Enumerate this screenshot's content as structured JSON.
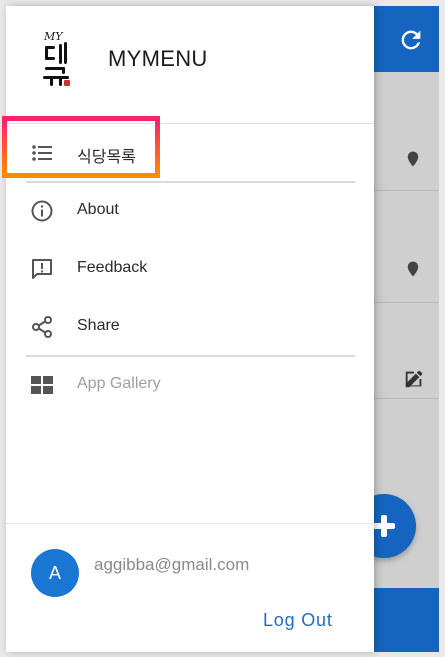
{
  "drawer": {
    "app_title": "MYMENU",
    "logo_text": "MY메뉴",
    "nav_items": [
      {
        "label": "식당목록",
        "icon": "list-icon"
      },
      {
        "label": "About",
        "icon": "info-icon"
      },
      {
        "label": "Feedback",
        "icon": "feedback-icon"
      },
      {
        "label": "Share",
        "icon": "share-icon"
      },
      {
        "label": "App Gallery",
        "icon": "grid-icon"
      }
    ],
    "user": {
      "avatar_initial": "A",
      "email": "aggibba@gmail.com"
    },
    "logout_label": "Log Out"
  },
  "background": {
    "header_icon": "refresh-icon",
    "fab_icon": "plus-icon"
  },
  "colors": {
    "primary": "#1565c0",
    "avatar": "#1976d2",
    "logout": "#1e6fc2",
    "highlight_top": "#ff1f6b",
    "highlight_bottom": "#ff8a00"
  }
}
